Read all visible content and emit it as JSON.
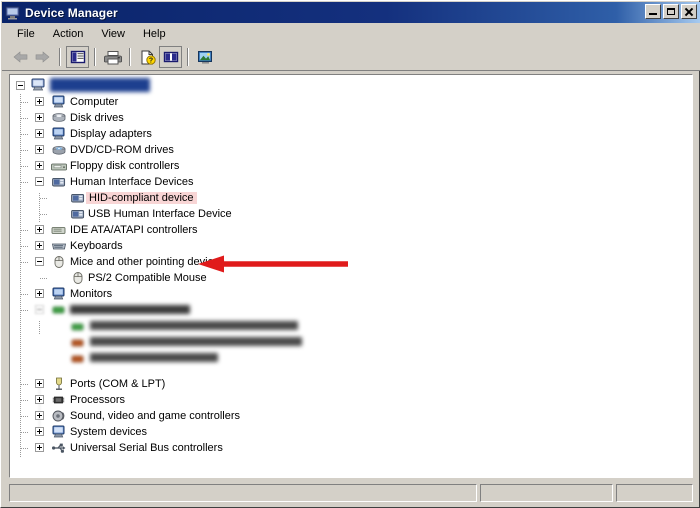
{
  "window": {
    "title": "Device Manager",
    "title_icon": "monitor-icon",
    "controls": {
      "minimize": "Minimize",
      "maximize": "Maximize",
      "close": "Close"
    }
  },
  "menubar": {
    "items": [
      {
        "label": "File"
      },
      {
        "label": "Action"
      },
      {
        "label": "View"
      },
      {
        "label": "Help"
      }
    ]
  },
  "toolbar": {
    "items": [
      {
        "name": "back-arrow-icon",
        "tooltip": "Back",
        "disabled": true
      },
      {
        "name": "forward-arrow-icon",
        "tooltip": "Forward",
        "disabled": true
      },
      {
        "name": "show-hide-console-tree-icon",
        "tooltip": "Show/Hide Console Tree",
        "disabled": false
      },
      {
        "name": "print-icon",
        "tooltip": "Print",
        "disabled": false
      },
      {
        "name": "properties-help-icon",
        "tooltip": "Properties",
        "disabled": false
      },
      {
        "name": "split-panel-icon",
        "tooltip": "View",
        "disabled": false
      },
      {
        "name": "scan-hardware-changes-icon",
        "tooltip": "Scan for hardware changes",
        "disabled": false
      }
    ]
  },
  "tree": {
    "root": {
      "name": "computer-root-node",
      "label": "",
      "redacted": true,
      "expander": "minus",
      "icon": "computer-icon"
    },
    "nodes": [
      {
        "label": "Computer",
        "icon": "computer-icon",
        "expander": "plus",
        "indent": 1
      },
      {
        "label": "Disk drives",
        "icon": "disk-drive-icon",
        "expander": "plus",
        "indent": 1
      },
      {
        "label": "Display adapters",
        "icon": "display-icon",
        "expander": "plus",
        "indent": 1
      },
      {
        "label": "DVD/CD-ROM drives",
        "icon": "cdrom-icon",
        "expander": "plus",
        "indent": 1
      },
      {
        "label": "Floppy disk controllers",
        "icon": "floppy-icon",
        "expander": "plus",
        "indent": 1
      },
      {
        "label": "Human Interface Devices",
        "icon": "hid-icon",
        "expander": "minus",
        "indent": 1
      },
      {
        "label": "HID-compliant device",
        "icon": "hid-icon",
        "expander": "none",
        "indent": 2,
        "highlighted": true
      },
      {
        "label": "USB Human Interface Device",
        "icon": "hid-icon",
        "expander": "none",
        "indent": 2
      },
      {
        "label": "IDE ATA/ATAPI controllers",
        "icon": "ide-icon",
        "expander": "plus",
        "indent": 1
      },
      {
        "label": "Keyboards",
        "icon": "keyboard-icon",
        "expander": "plus",
        "indent": 1
      },
      {
        "label": "Mice and other pointing devices",
        "icon": "mouse-icon",
        "expander": "minus",
        "indent": 1
      },
      {
        "label": "PS/2 Compatible Mouse",
        "icon": "mouse-icon",
        "expander": "none",
        "indent": 2
      },
      {
        "label": "Monitors",
        "icon": "monitor-icon",
        "expander": "plus",
        "indent": 1
      },
      {
        "label": "",
        "icon": "network-icon",
        "expander": "minus",
        "indent": 1,
        "redacted": true,
        "redact_width": 120,
        "redact_color": "#3b3b3b"
      },
      {
        "label": "",
        "icon": "network-icon",
        "expander": "none",
        "indent": 2,
        "redacted": true,
        "redact_width": 208,
        "redact_color": "#4a4a4a"
      },
      {
        "label": "",
        "icon": "network-icon",
        "expander": "none",
        "indent": 2,
        "redacted": true,
        "redact_width": 212,
        "redact_color": "#4a4a4a"
      },
      {
        "label": "",
        "icon": "network-icon",
        "expander": "none",
        "indent": 2,
        "redacted": true,
        "redact_width": 128,
        "redact_color": "#4a4a4a"
      },
      {
        "label": "Ports (COM & LPT)",
        "icon": "port-icon",
        "expander": "plus",
        "indent": 1
      },
      {
        "label": "Processors",
        "icon": "processor-icon",
        "expander": "plus",
        "indent": 1
      },
      {
        "label": "Sound, video and game controllers",
        "icon": "sound-icon",
        "expander": "plus",
        "indent": 1
      },
      {
        "label": "System devices",
        "icon": "system-icon",
        "expander": "plus",
        "indent": 1
      },
      {
        "label": "Universal Serial Bus controllers",
        "icon": "usb-icon",
        "expander": "plus",
        "indent": 1
      }
    ]
  },
  "annotation": {
    "arrow": {
      "name": "red-pointer-arrow",
      "direction": "left",
      "color": "#e01b1b",
      "points_to": "HID-compliant device"
    }
  },
  "statusbar": {
    "panes": [
      "",
      "",
      ""
    ]
  },
  "colors": {
    "titlebar_start": "#0a246a",
    "titlebar_end": "#a6caf0",
    "window_face": "#d4d0c8",
    "tree_background": "#ffffff",
    "selection_highlight": "#f8d5d5",
    "arrow_red": "#e01b1b"
  }
}
